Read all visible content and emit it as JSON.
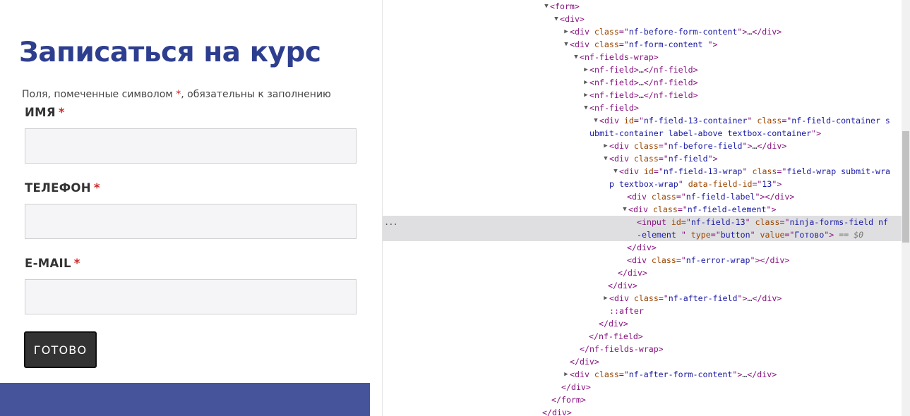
{
  "form": {
    "title": "Записаться на курс",
    "required_note_before": "Поля, помеченные символом ",
    "required_star": "*",
    "required_note_after": ", обязательны к заполнению",
    "fields": [
      {
        "label": "ИМЯ",
        "star": "*",
        "value": ""
      },
      {
        "label": "ТЕЛЕФОН",
        "star": "*",
        "value": ""
      },
      {
        "label": "E-MAIL",
        "star": "*",
        "value": ""
      }
    ],
    "submit_label": "ГОТОВО"
  },
  "colors": {
    "title": "#2e3e8f",
    "required": "#d02727",
    "button_bg": "#333333",
    "footer_band": "#46549c",
    "selected_row": "#dfdfe1"
  },
  "devtools": {
    "selected_marker": "...",
    "rows": [
      {
        "arrow": "down",
        "segments": [
          {
            "t": "tag",
            "x": "<form>"
          }
        ]
      },
      {
        "arrow": "down",
        "segments": [
          {
            "t": "tag",
            "x": "<div>"
          }
        ]
      },
      {
        "arrow": "right",
        "segments": [
          {
            "t": "tag",
            "x": "<div "
          },
          {
            "t": "attr",
            "x": "class"
          },
          {
            "t": "tag",
            "x": "=\""
          },
          {
            "t": "val",
            "x": "nf-before-form-content"
          },
          {
            "t": "tag",
            "x": "\">"
          },
          {
            "t": "gray",
            "x": "…"
          },
          {
            "t": "tag",
            "x": "</div>"
          }
        ]
      },
      {
        "arrow": "down",
        "segments": [
          {
            "t": "tag",
            "x": "<div "
          },
          {
            "t": "attr",
            "x": "class"
          },
          {
            "t": "tag",
            "x": "=\""
          },
          {
            "t": "val",
            "x": "nf-form-content "
          },
          {
            "t": "tag",
            "x": "\">"
          }
        ]
      },
      {
        "arrow": "down",
        "segments": [
          {
            "t": "tag",
            "x": "<nf-fields-wrap>"
          }
        ]
      },
      {
        "arrow": "right",
        "segments": [
          {
            "t": "tag",
            "x": "<nf-field>"
          },
          {
            "t": "gray",
            "x": "…"
          },
          {
            "t": "tag",
            "x": "</nf-field>"
          }
        ]
      },
      {
        "arrow": "right",
        "segments": [
          {
            "t": "tag",
            "x": "<nf-field>"
          },
          {
            "t": "gray",
            "x": "…"
          },
          {
            "t": "tag",
            "x": "</nf-field>"
          }
        ]
      },
      {
        "arrow": "right",
        "segments": [
          {
            "t": "tag",
            "x": "<nf-field>"
          },
          {
            "t": "gray",
            "x": "…"
          },
          {
            "t": "tag",
            "x": "</nf-field>"
          }
        ]
      },
      {
        "arrow": "down",
        "segments": [
          {
            "t": "tag",
            "x": "<nf-field>"
          }
        ]
      },
      {
        "arrow": "down",
        "segments": [
          {
            "t": "tag",
            "x": "<div "
          },
          {
            "t": "attr",
            "x": "id"
          },
          {
            "t": "tag",
            "x": "=\""
          },
          {
            "t": "val",
            "x": "nf-field-13-container"
          },
          {
            "t": "tag",
            "x": "\" "
          },
          {
            "t": "attr",
            "x": "class"
          },
          {
            "t": "tag",
            "x": "=\""
          },
          {
            "t": "val",
            "x": "nf-field-container s"
          }
        ]
      },
      {
        "arrow": "none",
        "segments": [
          {
            "t": "val",
            "x": "ubmit-container  label-above  textbox-container"
          },
          {
            "t": "tag",
            "x": "\">"
          }
        ]
      },
      {
        "arrow": "right",
        "segments": [
          {
            "t": "tag",
            "x": "<div "
          },
          {
            "t": "attr",
            "x": "class"
          },
          {
            "t": "tag",
            "x": "=\""
          },
          {
            "t": "val",
            "x": "nf-before-field"
          },
          {
            "t": "tag",
            "x": "\">"
          },
          {
            "t": "gray",
            "x": "…"
          },
          {
            "t": "tag",
            "x": "</div>"
          }
        ]
      },
      {
        "arrow": "down",
        "segments": [
          {
            "t": "tag",
            "x": "<div "
          },
          {
            "t": "attr",
            "x": "class"
          },
          {
            "t": "tag",
            "x": "=\""
          },
          {
            "t": "val",
            "x": "nf-field"
          },
          {
            "t": "tag",
            "x": "\">"
          }
        ]
      },
      {
        "arrow": "down",
        "segments": [
          {
            "t": "tag",
            "x": "<div "
          },
          {
            "t": "attr",
            "x": "id"
          },
          {
            "t": "tag",
            "x": "=\""
          },
          {
            "t": "val",
            "x": "nf-field-13-wrap"
          },
          {
            "t": "tag",
            "x": "\" "
          },
          {
            "t": "attr",
            "x": "class"
          },
          {
            "t": "tag",
            "x": "=\""
          },
          {
            "t": "val",
            "x": "field-wrap submit-wra"
          }
        ]
      },
      {
        "arrow": "none",
        "segments": [
          {
            "t": "val",
            "x": "p textbox-wrap"
          },
          {
            "t": "tag",
            "x": "\" "
          },
          {
            "t": "attr",
            "x": "data-field-id"
          },
          {
            "t": "tag",
            "x": "=\""
          },
          {
            "t": "val",
            "x": "13"
          },
          {
            "t": "tag",
            "x": "\">"
          }
        ]
      },
      {
        "arrow": "none",
        "segments": [
          {
            "t": "tag",
            "x": "<div "
          },
          {
            "t": "attr",
            "x": "class"
          },
          {
            "t": "tag",
            "x": "=\""
          },
          {
            "t": "val",
            "x": "nf-field-label"
          },
          {
            "t": "tag",
            "x": "\"></div>"
          }
        ]
      },
      {
        "arrow": "down",
        "segments": [
          {
            "t": "tag",
            "x": "<div "
          },
          {
            "t": "attr",
            "x": "class"
          },
          {
            "t": "tag",
            "x": "=\""
          },
          {
            "t": "val",
            "x": "nf-field-element"
          },
          {
            "t": "tag",
            "x": "\">"
          }
        ]
      },
      {
        "arrow": "none",
        "selected": true,
        "segments": [
          {
            "t": "tag",
            "x": "<input "
          },
          {
            "t": "attr",
            "x": "id"
          },
          {
            "t": "tag",
            "x": "=\""
          },
          {
            "t": "val",
            "x": "nf-field-13"
          },
          {
            "t": "tag",
            "x": "\" "
          },
          {
            "t": "attr",
            "x": "class"
          },
          {
            "t": "tag",
            "x": "=\""
          },
          {
            "t": "val",
            "x": "ninja-forms-field nf"
          }
        ]
      },
      {
        "arrow": "none",
        "selected": true,
        "segments": [
          {
            "t": "val",
            "x": "-element "
          },
          {
            "t": "tag",
            "x": "\" "
          },
          {
            "t": "attr",
            "x": "type"
          },
          {
            "t": "tag",
            "x": "=\""
          },
          {
            "t": "val",
            "x": "button"
          },
          {
            "t": "tag",
            "x": "\" "
          },
          {
            "t": "attr",
            "x": "value"
          },
          {
            "t": "tag",
            "x": "=\""
          },
          {
            "t": "val",
            "x": "Готово"
          },
          {
            "t": "tag",
            "x": "\">"
          },
          {
            "t": "eq0",
            "x": " == $0"
          }
        ]
      },
      {
        "arrow": "none",
        "segments": [
          {
            "t": "tag",
            "x": "</div>"
          }
        ]
      },
      {
        "arrow": "none",
        "segments": [
          {
            "t": "tag",
            "x": "<div "
          },
          {
            "t": "attr",
            "x": "class"
          },
          {
            "t": "tag",
            "x": "=\""
          },
          {
            "t": "val",
            "x": "nf-error-wrap"
          },
          {
            "t": "tag",
            "x": "\"></div>"
          }
        ]
      },
      {
        "arrow": "none",
        "segments": [
          {
            "t": "tag",
            "x": "</div>"
          }
        ]
      },
      {
        "arrow": "none",
        "segments": [
          {
            "t": "tag",
            "x": "</div>"
          }
        ]
      },
      {
        "arrow": "right",
        "segments": [
          {
            "t": "tag",
            "x": "<div "
          },
          {
            "t": "attr",
            "x": "class"
          },
          {
            "t": "tag",
            "x": "=\""
          },
          {
            "t": "val",
            "x": "nf-after-field"
          },
          {
            "t": "tag",
            "x": "\">"
          },
          {
            "t": "gray",
            "x": "…"
          },
          {
            "t": "tag",
            "x": "</div>"
          }
        ]
      },
      {
        "arrow": "none",
        "segments": [
          {
            "t": "tag",
            "x": "::after"
          }
        ]
      },
      {
        "arrow": "none",
        "segments": [
          {
            "t": "tag",
            "x": "</div>"
          }
        ]
      },
      {
        "arrow": "none",
        "segments": [
          {
            "t": "tag",
            "x": "</nf-field>"
          }
        ]
      },
      {
        "arrow": "none",
        "segments": [
          {
            "t": "tag",
            "x": "</nf-fields-wrap>"
          }
        ]
      },
      {
        "arrow": "none",
        "segments": [
          {
            "t": "tag",
            "x": "</div>"
          }
        ]
      },
      {
        "arrow": "right",
        "segments": [
          {
            "t": "tag",
            "x": "<div "
          },
          {
            "t": "attr",
            "x": "class"
          },
          {
            "t": "tag",
            "x": "=\""
          },
          {
            "t": "val",
            "x": "nf-after-form-content"
          },
          {
            "t": "tag",
            "x": "\">"
          },
          {
            "t": "gray",
            "x": "…"
          },
          {
            "t": "tag",
            "x": "</div>"
          }
        ]
      },
      {
        "arrow": "none",
        "segments": [
          {
            "t": "tag",
            "x": "</div>"
          }
        ]
      },
      {
        "arrow": "none",
        "segments": [
          {
            "t": "tag",
            "x": "</form>"
          }
        ]
      },
      {
        "arrow": "none",
        "segments": [
          {
            "t": "tag",
            "x": "</div>"
          }
        ]
      }
    ]
  }
}
